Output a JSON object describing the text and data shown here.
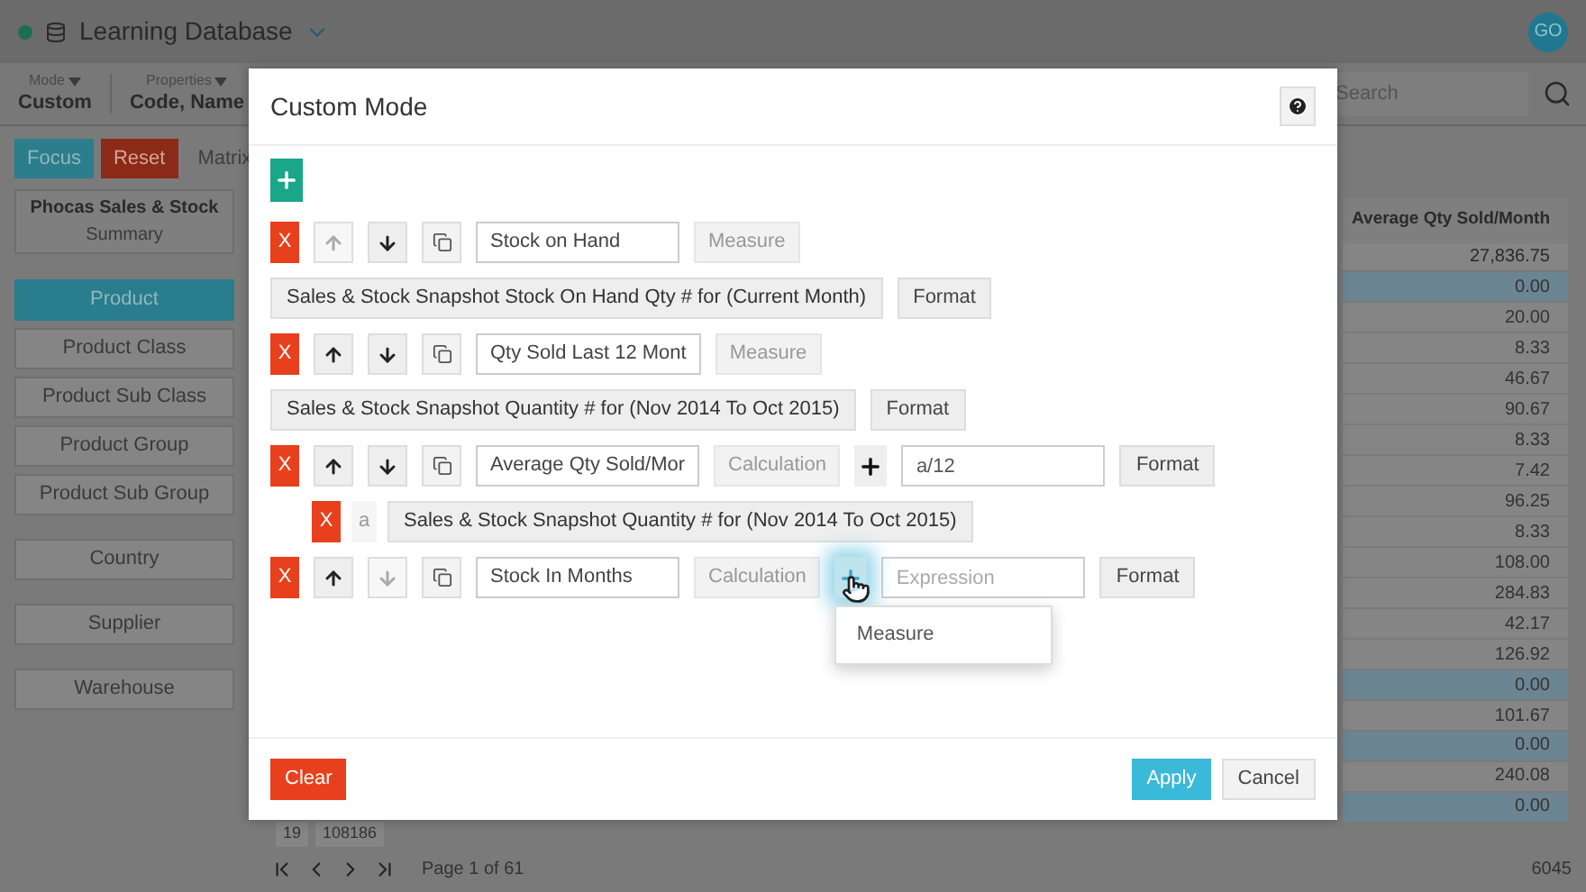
{
  "app_bar": {
    "title": "Learning Database",
    "avatar": "GO"
  },
  "toolbar": {
    "mode": {
      "label": "Mode",
      "value": "Custom"
    },
    "properties": {
      "label": "Properties",
      "value": "Code, Name"
    },
    "search": {
      "placeholder": "Search"
    }
  },
  "sidebar": {
    "buttons": [
      {
        "label": "Focus",
        "kind": "focus"
      },
      {
        "label": "Reset",
        "kind": "reset"
      },
      {
        "label": "Matrix",
        "kind": "plain"
      }
    ],
    "view": {
      "title": "Phocas Sales & Stock",
      "subtitle": "Summary"
    },
    "groups": [
      {
        "items": [
          {
            "label": "Product",
            "selected": true
          },
          {
            "label": "Product Class",
            "selected": false
          },
          {
            "label": "Product Sub Class",
            "selected": false
          },
          {
            "label": "Product Group",
            "selected": false
          },
          {
            "label": "Product Sub Group",
            "selected": false
          }
        ]
      },
      {
        "items": [
          {
            "label": "Country",
            "selected": false
          }
        ]
      },
      {
        "items": [
          {
            "label": "Supplier",
            "selected": false
          }
        ]
      },
      {
        "items": [
          {
            "label": "Warehouse",
            "selected": false
          }
        ]
      }
    ]
  },
  "table": {
    "column": "Average Qty Sold/Month",
    "total": "27,836.75",
    "rows": [
      {
        "value": "0.00",
        "selected": true
      },
      {
        "value": "20.00",
        "selected": false
      },
      {
        "value": "8.33",
        "selected": false
      },
      {
        "value": "46.67",
        "selected": false
      },
      {
        "value": "90.67",
        "selected": false
      },
      {
        "value": "8.33",
        "selected": false
      },
      {
        "value": "7.42",
        "selected": false
      },
      {
        "value": "96.25",
        "selected": false
      },
      {
        "value": "8.33",
        "selected": false
      },
      {
        "value": "108.00",
        "selected": false
      },
      {
        "value": "284.83",
        "selected": false
      },
      {
        "value": "42.17",
        "selected": false
      },
      {
        "value": "126.92",
        "selected": false
      },
      {
        "value": "0.00",
        "selected": true
      },
      {
        "value": "101.67",
        "selected": false
      },
      {
        "value": "0.00",
        "selected": true
      },
      {
        "value": "240.08",
        "selected": false
      },
      {
        "value": "0.00",
        "selected": true
      }
    ],
    "partial_row": [
      "19",
      "108186"
    ]
  },
  "pager": {
    "text": "Page 1 of 61",
    "count": "6045"
  },
  "dialog": {
    "title": "Custom Mode",
    "items": [
      {
        "kind": "measure",
        "delete": "X",
        "up_disabled": true,
        "down_disabled": false,
        "name": "Stock on Hand",
        "type": "Measure",
        "source": "Sales & Stock Snapshot Stock On Hand Qty # for (Current Month)",
        "format": "Format"
      },
      {
        "kind": "measure",
        "delete": "X",
        "up_disabled": false,
        "down_disabled": false,
        "name": "Qty Sold Last 12 Mont",
        "type": "Measure",
        "source": "Sales & Stock Snapshot Quantity # for (Nov 2014 To Oct 2015)",
        "format": "Format"
      },
      {
        "kind": "calculation",
        "delete": "X",
        "up_disabled": false,
        "down_disabled": false,
        "name": "Average Qty Sold/Mor",
        "type": "Calculation",
        "expression": "a/12",
        "menu_open": false,
        "format": "Format",
        "variables": [
          {
            "delete": "X",
            "letter": "a",
            "source": "Sales & Stock Snapshot Quantity # for (Nov 2014 To Oct 2015)"
          }
        ]
      },
      {
        "kind": "calculation",
        "delete": "X",
        "up_disabled": false,
        "down_disabled": true,
        "name": "Stock In Months",
        "type": "Calculation",
        "placeholder": "Expression",
        "menu_open": true,
        "menu": [
          "Measure"
        ],
        "format": "Format"
      }
    ],
    "clear": "Clear",
    "apply": "Apply",
    "cancel": "Cancel"
  }
}
